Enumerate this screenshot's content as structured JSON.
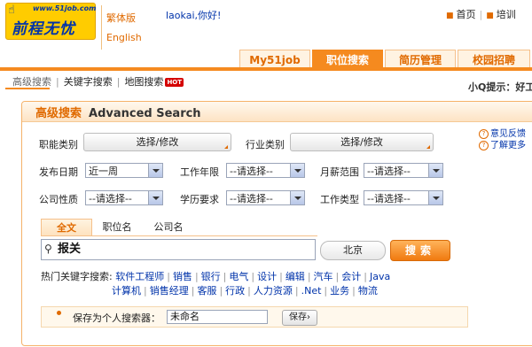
{
  "header": {
    "logo_url": "www.51job.com",
    "logo_text": "前程无忧",
    "lang_traditional": "繁体版",
    "lang_english": "English",
    "greeting": "laokai,你好!",
    "toplinks": [
      "首页",
      "培训"
    ]
  },
  "nav": {
    "tabs": [
      {
        "label": "My51job",
        "active": false
      },
      {
        "label": "职位搜索",
        "active": true
      },
      {
        "label": "简历管理",
        "active": false
      },
      {
        "label": "校园招聘",
        "active": false
      }
    ]
  },
  "subnav": {
    "items": [
      "高级搜索",
      "关键字搜索",
      "地图搜索"
    ],
    "hot_badge": "HOT",
    "tips": "小Q提示：好工"
  },
  "panel": {
    "title_cn": "高级搜索",
    "title_en": "Advanced Search",
    "feedback": "意见反馈",
    "learn_more": "了解更多",
    "function_label": "职能类别",
    "function_btn": "选择/修改",
    "industry_label": "行业类别",
    "industry_btn": "选择/修改",
    "post_date_label": "发布日期",
    "post_date_value": "近一周",
    "work_years_label": "工作年限",
    "work_years_value": "--请选择--",
    "salary_label": "月薪范围",
    "salary_value": "--请选择--",
    "company_type_label": "公司性质",
    "company_type_value": "--请选择--",
    "education_label": "学历要求",
    "education_value": "--请选择--",
    "job_type_label": "工作类型",
    "job_type_value": "--请选择--",
    "search_tabs": [
      "全文",
      "职位名",
      "公司名"
    ],
    "keyword_value": "报关",
    "city_value": "北京",
    "search_btn": "搜索",
    "hot_keywords_label": "热门关键字搜索:",
    "hot_keywords_row1": [
      "软件工程师",
      "销售",
      "银行",
      "电气",
      "设计",
      "编辑",
      "汽车",
      "会计",
      "Java"
    ],
    "hot_keywords_row2": [
      "计算机",
      "销售经理",
      "客服",
      "行政",
      "人力资源",
      ".Net",
      "业务",
      "物流"
    ],
    "save_label": "保存为个人搜索器：",
    "save_value": "未命名",
    "save_btn": "保存"
  }
}
